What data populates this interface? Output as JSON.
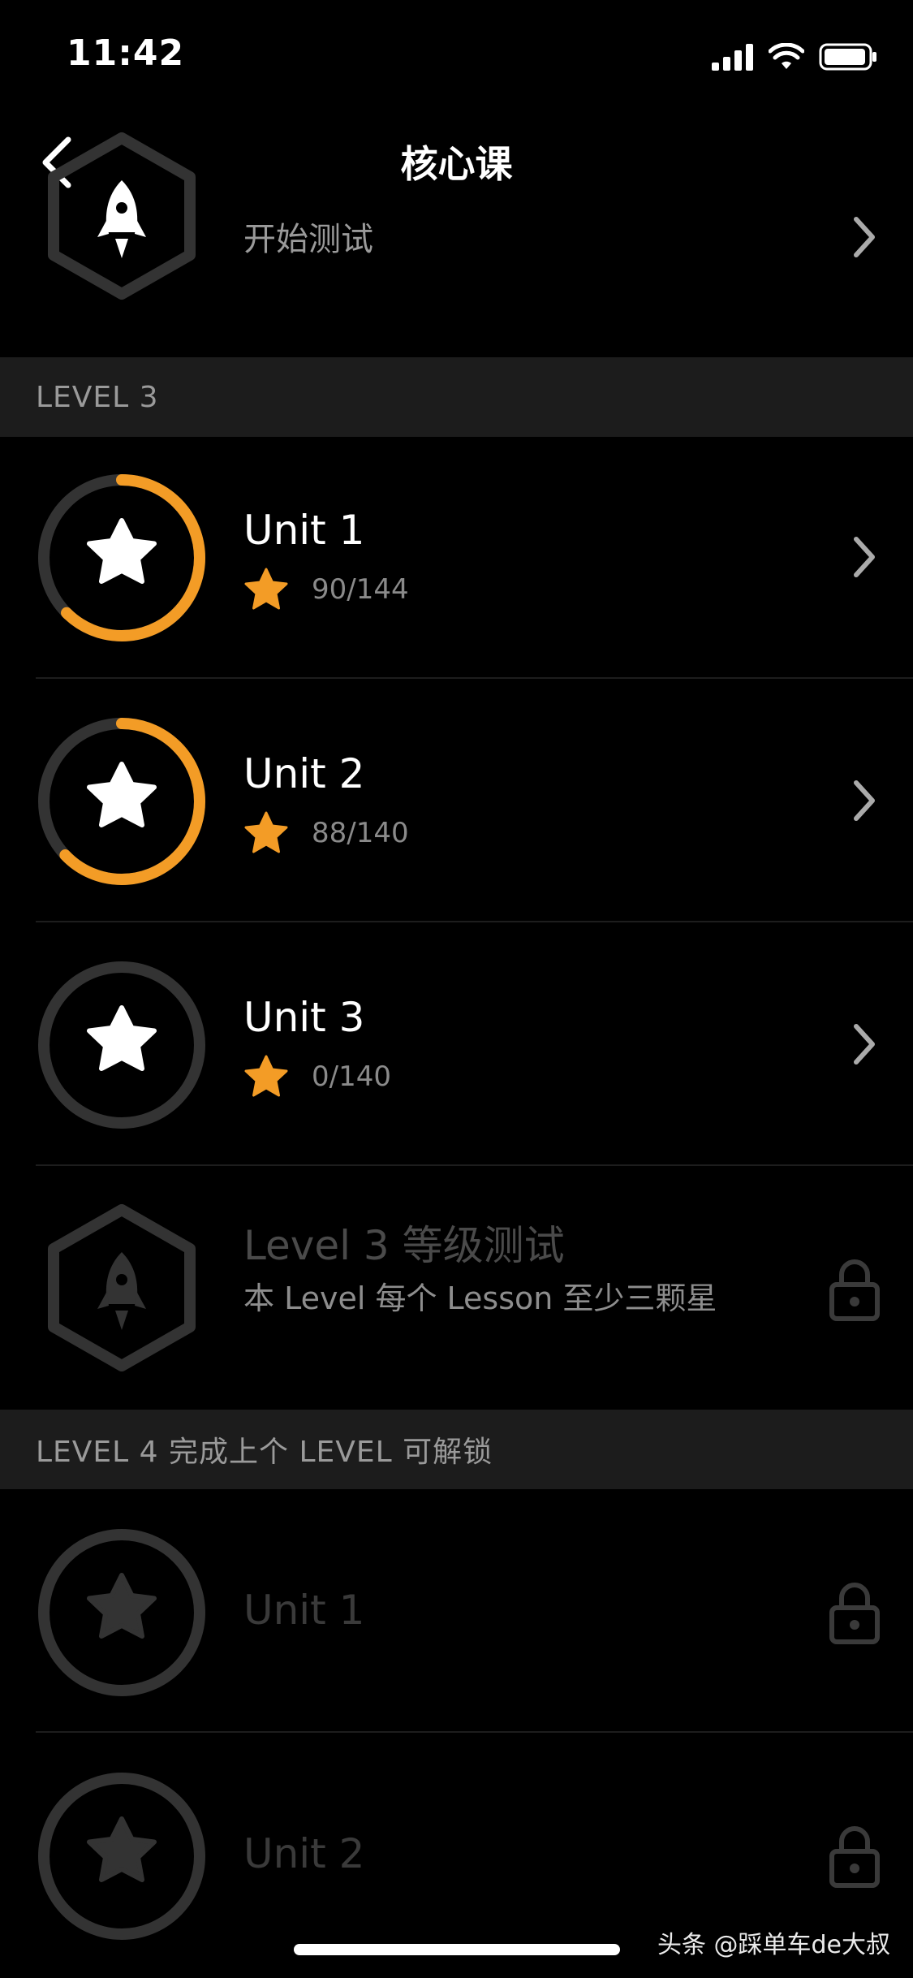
{
  "status_bar": {
    "time": "11:42"
  },
  "nav": {
    "title": "核心课"
  },
  "top_test": {
    "label": "开始测试"
  },
  "level3": {
    "header": "LEVEL 3",
    "units": [
      {
        "title": "Unit 1",
        "score": "90/144",
        "progress": 0.625
      },
      {
        "title": "Unit 2",
        "score": "88/140",
        "progress": 0.629
      },
      {
        "title": "Unit 3",
        "score": "0/140",
        "progress": 0
      }
    ],
    "test": {
      "title": "Level 3 等级测试",
      "subtitle": "本 Level 每个 Lesson 至少三颗星"
    }
  },
  "level4": {
    "header": "LEVEL 4  完成上个 LEVEL 可解锁",
    "units": [
      {
        "title": "Unit 1"
      },
      {
        "title": "Unit 2"
      }
    ]
  },
  "watermark": "头条 @踩单车de大叔",
  "colors": {
    "accent": "#F39C26",
    "ring_track": "#333333",
    "background": "#000000",
    "section_bg": "#1C1C1C"
  }
}
